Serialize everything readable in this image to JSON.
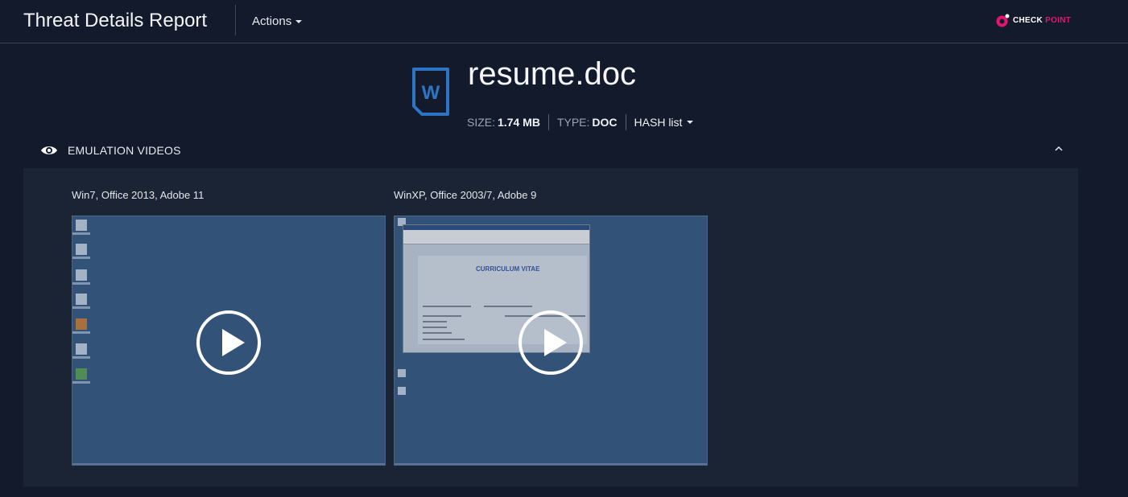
{
  "header": {
    "title": "Threat Details Report",
    "actions_label": "Actions",
    "brand": {
      "part1": "CHECK",
      "part2": "POINT",
      "accent_color": "#e2156f"
    }
  },
  "file": {
    "icon": "word-document-icon",
    "icon_letter": "W",
    "name": "resume.doc",
    "size_label": "SIZE:",
    "size_value": "1.74 MB",
    "type_label": "TYPE:",
    "type_value": "DOC",
    "hash_label": "HASH list"
  },
  "emulation": {
    "title": "EMULATION VIDEOS",
    "icon": "eye-icon",
    "collapse_icon": "chevron-up-icon",
    "videos": [
      {
        "label": "Win7, Office 2013, Adobe 11"
      },
      {
        "label": "WinXP, Office 2003/7, Adobe 9",
        "document_heading": "CURRICULUM VITAE"
      }
    ]
  }
}
